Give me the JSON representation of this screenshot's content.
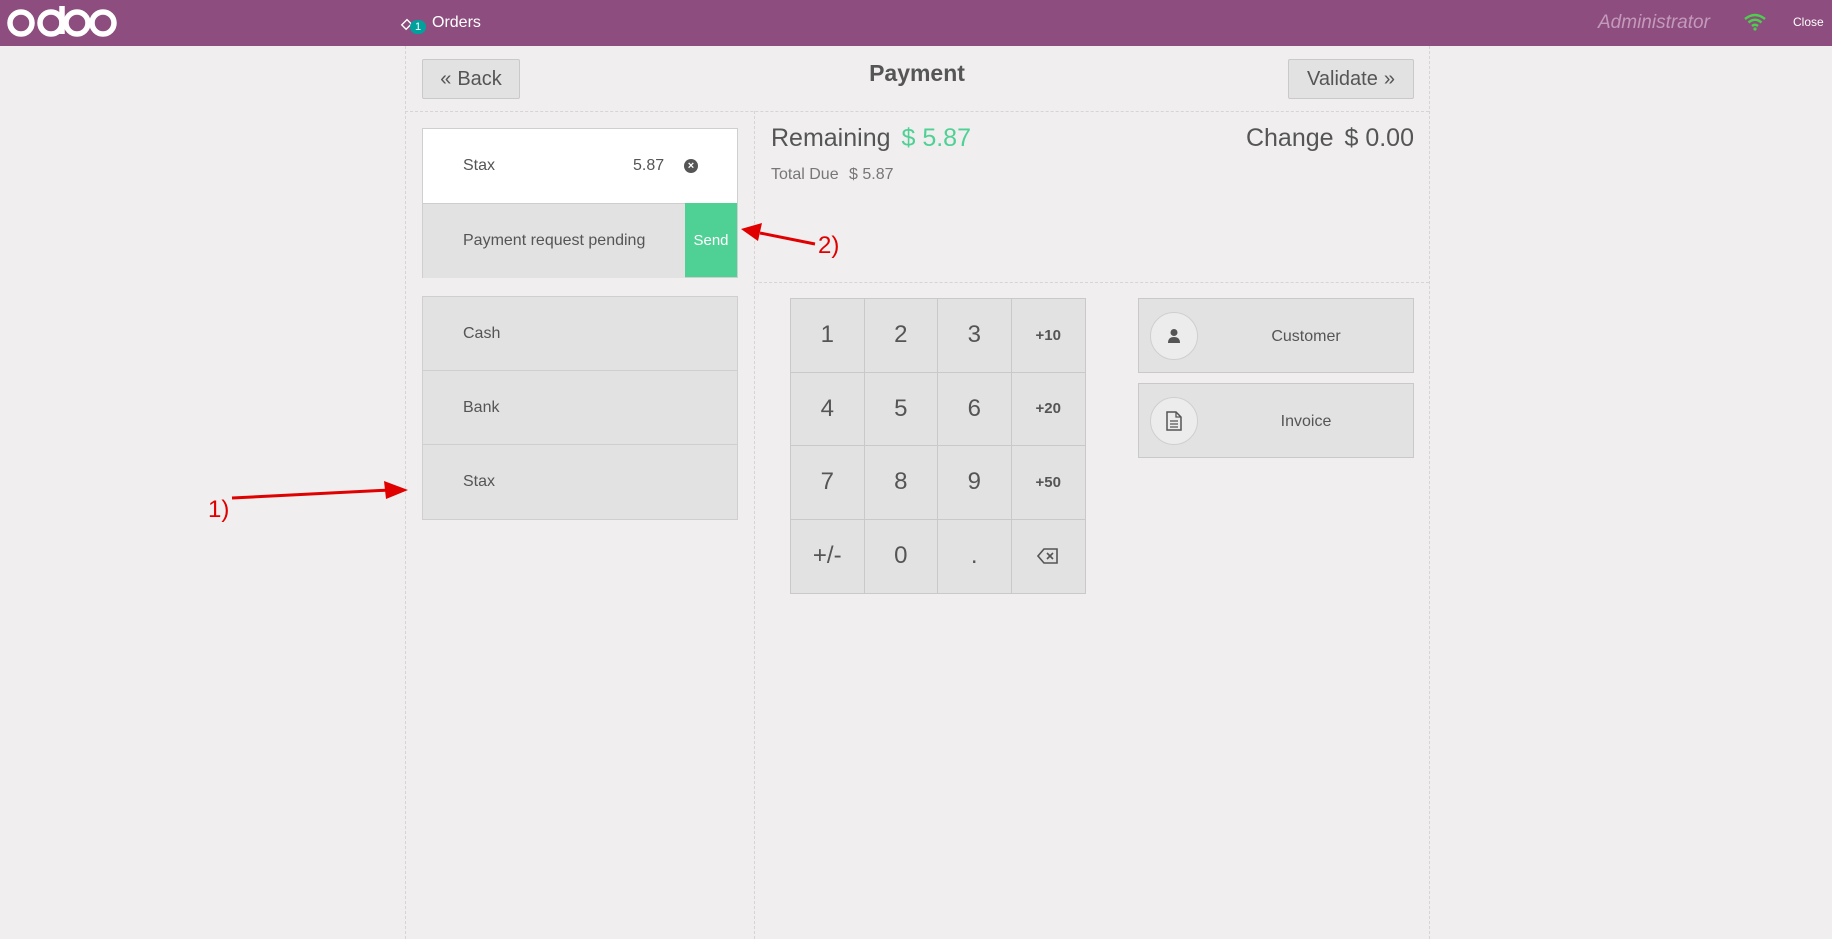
{
  "header": {
    "logo": "odoo",
    "orders_badge": "1",
    "orders_label": "Orders",
    "user": "Administrator",
    "close_label": "Close"
  },
  "controls": {
    "back_label": "Back",
    "title": "Payment",
    "validate_label": "Validate"
  },
  "paymentline": {
    "name": "Stax",
    "amount": "5.87",
    "status": "Payment request pending",
    "send_label": "Send"
  },
  "payment_methods": [
    "Cash",
    "Bank",
    "Stax"
  ],
  "summary": {
    "remaining_label": "Remaining",
    "remaining_value": "$ 5.87",
    "total_due_label": "Total Due",
    "total_due_value": "$ 5.87",
    "change_label": "Change",
    "change_value": "$ 0.00"
  },
  "numpad": [
    "1",
    "2",
    "3",
    "+10",
    "4",
    "5",
    "6",
    "+20",
    "7",
    "8",
    "9",
    "+50",
    "+/-",
    "0",
    "."
  ],
  "side_buttons": {
    "customer_label": "Customer",
    "invoice_label": "Invoice"
  },
  "annotations": {
    "one": "1)",
    "two": "2)"
  },
  "colors": {
    "header": "#8d4d7e",
    "accent_green": "#4fd195",
    "annotation_red": "#e00000"
  }
}
